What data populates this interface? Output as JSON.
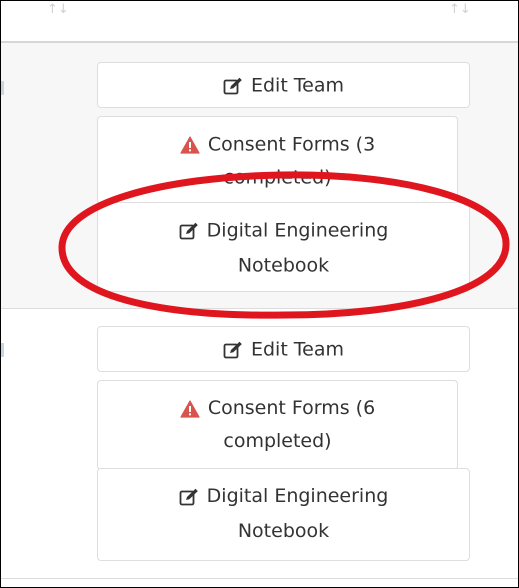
{
  "header": {
    "sort_glyph_left": "↑↓",
    "sort_glyph_right": "↑↓"
  },
  "rows": [
    {
      "edit_team_label": "Edit Team",
      "consent_label_line1": "Consent Forms (3",
      "consent_label_line2": "completed)",
      "notebook_label_line1": "Digital Engineering",
      "notebook_label_line2": "Notebook"
    },
    {
      "edit_team_label": "Edit Team",
      "consent_label_line1": "Consent Forms (6",
      "consent_label_line2": "completed)",
      "notebook_label_line1": "Digital Engineering",
      "notebook_label_line2": "Notebook"
    }
  ],
  "colors": {
    "highlight_oval": "#e0161f",
    "warning_icon": "#d9534f",
    "row_shaded": "#f7f7f7",
    "button_border": "#dedede"
  },
  "icons": {
    "edit": "edit-icon",
    "warning": "warning-icon"
  }
}
